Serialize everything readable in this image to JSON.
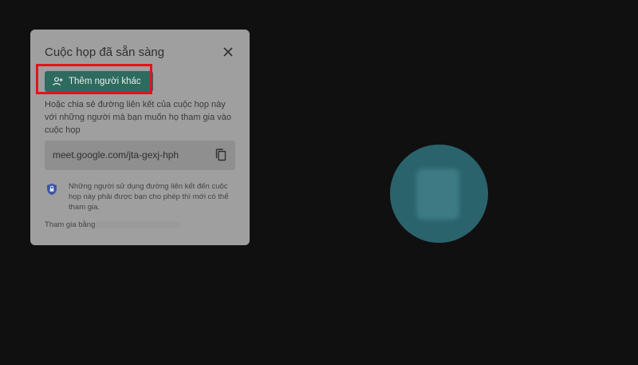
{
  "dialog": {
    "title": "Cuộc họp đã sẵn sàng",
    "add_button_label": "Thêm người khác",
    "share_lines": [
      "Hoặc chia sẻ đường liên kết của cuộc họp này",
      "với những người mà bạn muốn họ tham gia vào",
      "cuộc họp"
    ],
    "meeting_link": "meet.google.com/jta-gexj-hph",
    "info_lines": [
      "Những người sử dụng đường liên kết đến cuộc",
      "họp này phải được bạn cho phép thì mới có thể",
      "tham gia."
    ],
    "join_label": "Tham gia bằng"
  },
  "icons": {
    "close": "close-icon",
    "add_person": "person-add-icon",
    "copy": "copy-icon",
    "shield": "shield-icon"
  },
  "colors": {
    "button_bg": "#2e6b5f",
    "highlight": "#e0141b",
    "avatar_bg": "#2a636c",
    "dialog_bg": "#9f9f9f"
  }
}
